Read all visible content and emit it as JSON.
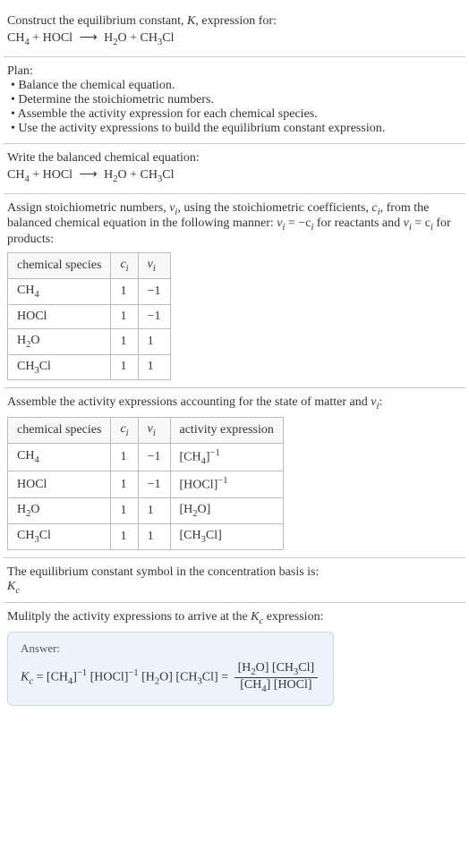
{
  "intro": {
    "line1_pre": "Construct the equilibrium constant, ",
    "line1_var": "K",
    "line1_post": ", expression for:"
  },
  "equation": {
    "ch4": "CH",
    "plus": " + ",
    "hocl": "HOCl",
    "arrow": "⟶",
    "h2o": "H",
    "ch3cl": "CH",
    "cl": "Cl",
    "o": "O",
    "sub2": "2",
    "sub3": "3",
    "sub4": "4"
  },
  "plan": {
    "heading": "Plan:",
    "items": [
      "Balance the chemical equation.",
      "Determine the stoichiometric numbers.",
      "Assemble the activity expression for each chemical species.",
      "Use the activity expressions to build the equilibrium constant expression."
    ]
  },
  "balanced_heading": "Write the balanced chemical equation:",
  "stoich": {
    "text1": "Assign stoichiometric numbers, ",
    "nu": "ν",
    "sub_i": "i",
    "text2": ", using the stoichiometric coefficients, ",
    "c": "c",
    "text3": ", from the balanced chemical equation in the following manner: ",
    "eq1_lhs": "ν",
    "eq1_rhs": " = −c",
    "reactants": " for reactants and ",
    "eq2_rhs": " = c",
    "products": " for products:"
  },
  "table1": {
    "headers": {
      "species": "chemical species",
      "ci": "c",
      "nu": "ν",
      "sub": "i"
    },
    "rows": [
      {
        "c": "1",
        "nu": "−1"
      },
      {
        "c": "1",
        "nu": "−1"
      },
      {
        "c": "1",
        "nu": "1"
      },
      {
        "c": "1",
        "nu": "1"
      }
    ]
  },
  "activity_heading_pre": "Assemble the activity expressions accounting for the state of matter and ",
  "activity_heading_post": ":",
  "table2": {
    "headers": {
      "species": "chemical species",
      "ci": "c",
      "nu": "ν",
      "act": "activity expression",
      "sub": "i"
    },
    "rows": [
      {
        "c": "1",
        "nu": "−1"
      },
      {
        "c": "1",
        "nu": "−1"
      },
      {
        "c": "1",
        "nu": "1"
      },
      {
        "c": "1",
        "nu": "1"
      }
    ]
  },
  "kc_text": {
    "line1": "The equilibrium constant symbol in the concentration basis is:",
    "kc": "K",
    "sub_c": "c"
  },
  "multiply": {
    "pre": "Mulitply the activity expressions to arrive at the ",
    "post": " expression:"
  },
  "answer": {
    "label": "Answer:",
    "eq_pre": " = [CH",
    "neg1": "−1",
    "lbr": "[",
    "rbr": "]"
  },
  "chart_data": {
    "type": "table",
    "title": "Stoichiometric numbers and activity expressions",
    "tables": [
      {
        "columns": [
          "chemical species",
          "c_i",
          "ν_i"
        ],
        "rows": [
          [
            "CH4",
            1,
            -1
          ],
          [
            "HOCl",
            1,
            -1
          ],
          [
            "H2O",
            1,
            1
          ],
          [
            "CH3Cl",
            1,
            1
          ]
        ]
      },
      {
        "columns": [
          "chemical species",
          "c_i",
          "ν_i",
          "activity expression"
        ],
        "rows": [
          [
            "CH4",
            1,
            -1,
            "[CH4]^-1"
          ],
          [
            "HOCl",
            1,
            -1,
            "[HOCl]^-1"
          ],
          [
            "H2O",
            1,
            1,
            "[H2O]"
          ],
          [
            "CH3Cl",
            1,
            1,
            "[CH3Cl]"
          ]
        ]
      }
    ],
    "equilibrium_expression": "Kc = [H2O][CH3Cl] / ([CH4][HOCl])"
  }
}
